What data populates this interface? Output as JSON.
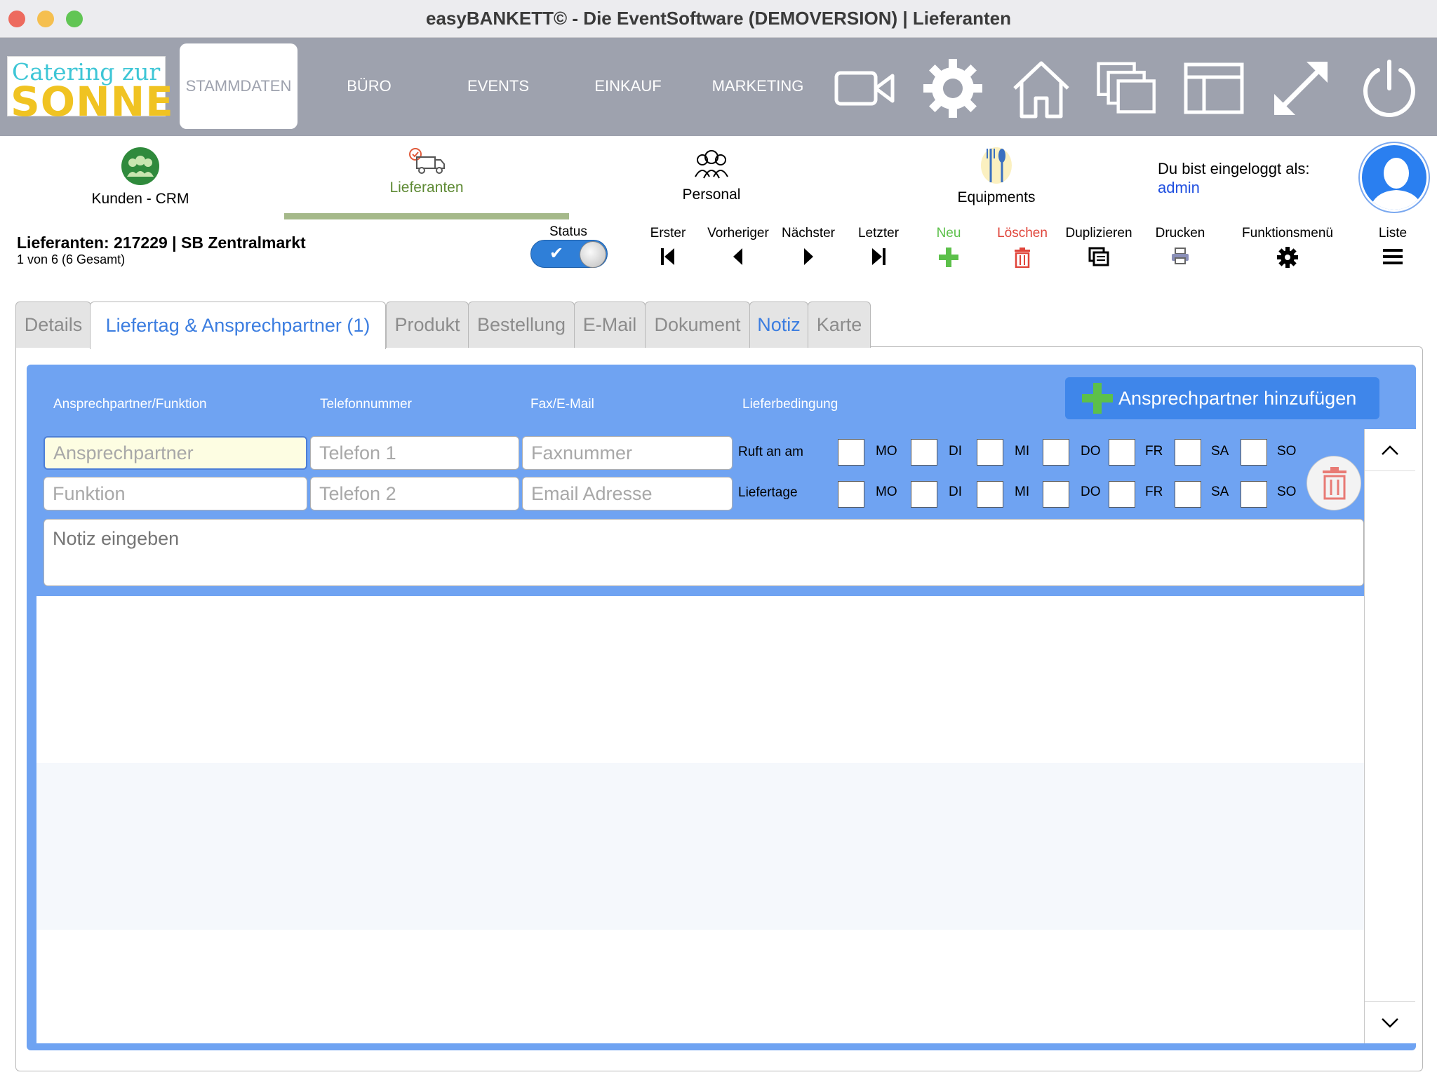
{
  "window": {
    "title": "easyBANKETT© - Die EventSoftware (DEMOVERSION) | Lieferanten"
  },
  "logo": {
    "line1": "Catering zur",
    "line2": "SONNE"
  },
  "topnav": {
    "tabs": [
      {
        "label": "STAMMDATEN",
        "active": true
      },
      {
        "label": "BÜRO"
      },
      {
        "label": "EVENTS"
      },
      {
        "label": "EINKAUF"
      },
      {
        "label": "MARKETING"
      }
    ],
    "icons": [
      "video-icon",
      "gear-icon",
      "home-icon",
      "windows-icon",
      "layout-icon",
      "fullscreen-icon",
      "power-icon"
    ]
  },
  "modules": [
    {
      "label": "Kunden - CRM"
    },
    {
      "label": "Lieferanten",
      "active": true
    },
    {
      "label": "Personal"
    },
    {
      "label": "Equipments"
    }
  ],
  "login": {
    "label": "Du bist eingeloggt als:",
    "user": "admin"
  },
  "record": {
    "title": "Lieferanten: 217229 | SB Zentralmarkt",
    "count": "1 von 6 (6 Gesamt)",
    "status_label": "Status"
  },
  "toolbar": {
    "first": "Erster",
    "previous": "Vorheriger",
    "next": "Nächster",
    "last": "Letzter",
    "new": "Neu",
    "delete": "Löschen",
    "duplicate": "Duplizieren",
    "print": "Drucken",
    "menu": "Funktionsmenü",
    "list": "Liste"
  },
  "colors": {
    "accent_blue": "#6fa3f2",
    "new_green": "#5cc04a",
    "delete_red": "#e0443a",
    "nav_gray": "#9ea2ae"
  },
  "tabs": [
    {
      "label": "Details"
    },
    {
      "label": "Liefertag & Ansprechpartner (1)",
      "active": true
    },
    {
      "label": "Produkt"
    },
    {
      "label": "Bestellung"
    },
    {
      "label": "E-Mail"
    },
    {
      "label": "Dokument"
    },
    {
      "label": "Notiz"
    },
    {
      "label": "Karte"
    }
  ],
  "portal": {
    "headers": {
      "contact": "Ansprechpartner/Funktion",
      "phone": "Telefonnummer",
      "fax": "Fax/E-Mail",
      "delivery": "Lieferbedingung"
    },
    "add_button": "Ansprechpartner hinzufügen",
    "fields": {
      "contact_placeholder": "Ansprechpartner",
      "function_placeholder": "Funktion",
      "phone1_placeholder": "Telefon 1",
      "phone2_placeholder": "Telefon 2",
      "fax_placeholder": "Faxnummer",
      "email_placeholder": "Email Adresse",
      "note_placeholder": "Notiz eingeben"
    },
    "row_labels": {
      "calls": "Ruft an am",
      "delivery_days": "Liefertage"
    },
    "days": [
      "MO",
      "DI",
      "MI",
      "DO",
      "FR",
      "SA",
      "SO"
    ]
  }
}
